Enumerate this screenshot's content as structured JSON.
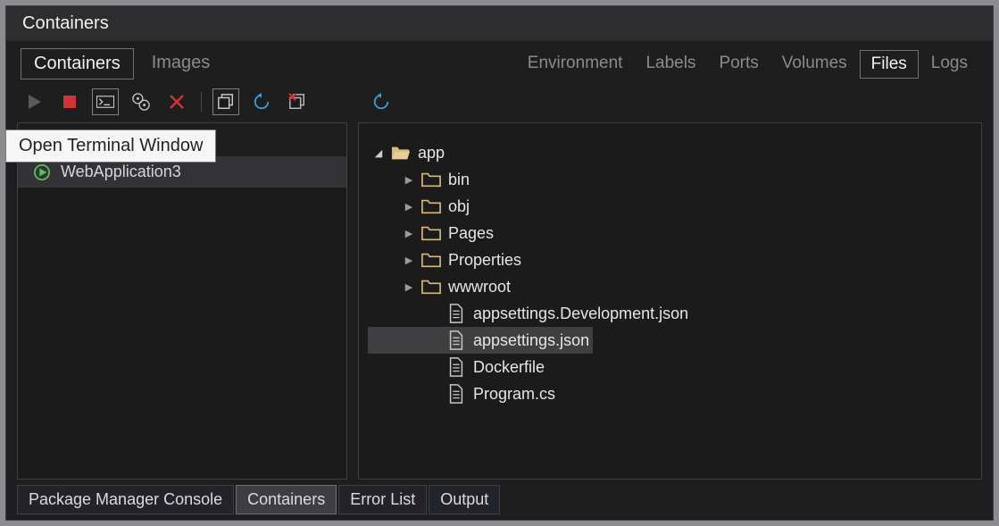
{
  "title": "Containers",
  "subtabs_left": [
    "Containers",
    "Images"
  ],
  "subtabs_left_active": 0,
  "subtabs_right": [
    "Environment",
    "Labels",
    "Ports",
    "Volumes",
    "Files",
    "Logs"
  ],
  "subtabs_right_active": 4,
  "tooltip": "Open Terminal Window",
  "left_section_header_suffix": "s",
  "container_items": [
    {
      "name": "WebApplication3",
      "running": true
    }
  ],
  "file_tree": [
    {
      "label": "app",
      "depth": 0,
      "kind": "folder-open",
      "expander": "open"
    },
    {
      "label": "bin",
      "depth": 1,
      "kind": "folder",
      "expander": "closed"
    },
    {
      "label": "obj",
      "depth": 1,
      "kind": "folder",
      "expander": "closed"
    },
    {
      "label": "Pages",
      "depth": 1,
      "kind": "folder",
      "expander": "closed"
    },
    {
      "label": "Properties",
      "depth": 1,
      "kind": "folder",
      "expander": "closed"
    },
    {
      "label": "wwwroot",
      "depth": 1,
      "kind": "folder",
      "expander": "closed"
    },
    {
      "label": "appsettings.Development.json",
      "depth": 2,
      "kind": "file",
      "expander": "none"
    },
    {
      "label": "appsettings.json",
      "depth": 2,
      "kind": "file",
      "expander": "none",
      "selected": true
    },
    {
      "label": "Dockerfile",
      "depth": 2,
      "kind": "file",
      "expander": "none"
    },
    {
      "label": "Program.cs",
      "depth": 2,
      "kind": "file",
      "expander": "none"
    }
  ],
  "bottom_tabs": [
    "Package Manager Console",
    "Containers",
    "Error List",
    "Output"
  ],
  "bottom_tabs_active": 1
}
